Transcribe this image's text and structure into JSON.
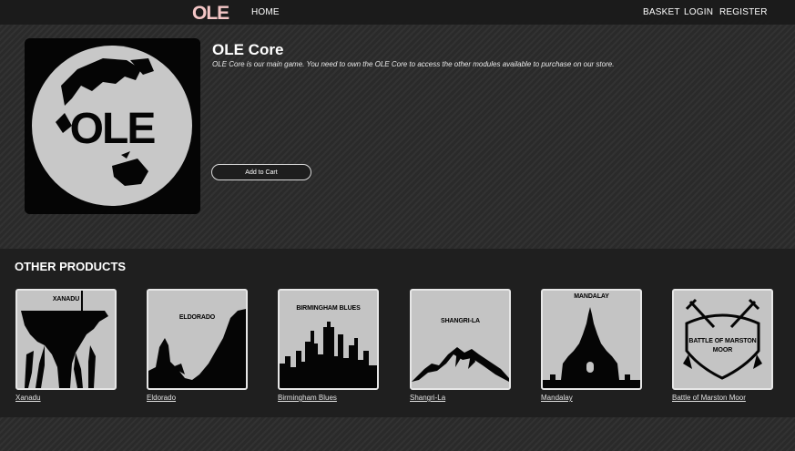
{
  "header": {
    "logo_text": "OLE",
    "nav": {
      "home": "HOME",
      "basket": "BASKET",
      "login": "LOGIN",
      "register": "REGISTER"
    }
  },
  "product": {
    "title": "OLE Core",
    "description": "OLE Core is our main game. You need to own the OLE Core to access the other modules available to purchase on our store.",
    "image_text": "OLE",
    "add_to_cart": "Add to Cart"
  },
  "other_products": {
    "heading": "OTHER PRODUCTS",
    "items": [
      {
        "image_title": "XANADU",
        "name": "Xanadu"
      },
      {
        "image_title": "ELDORADO",
        "name": "Eldorado"
      },
      {
        "image_title": "BIRMINGHAM BLUES",
        "name": "Birmingham Blues"
      },
      {
        "image_title": "SHANGRI-LA",
        "name": "Shangri-La"
      },
      {
        "image_title": "MANDALAY",
        "name": "Mandalay"
      },
      {
        "image_title_line1": "BATTLE OF MARSTON",
        "image_title_line2": "MOOR",
        "name": "Battle of Marston Moor"
      }
    ]
  },
  "colors": {
    "logo": "#f4c6c6",
    "thumb_bg": "#c4c4c4",
    "bar": "#1b1b1b"
  }
}
